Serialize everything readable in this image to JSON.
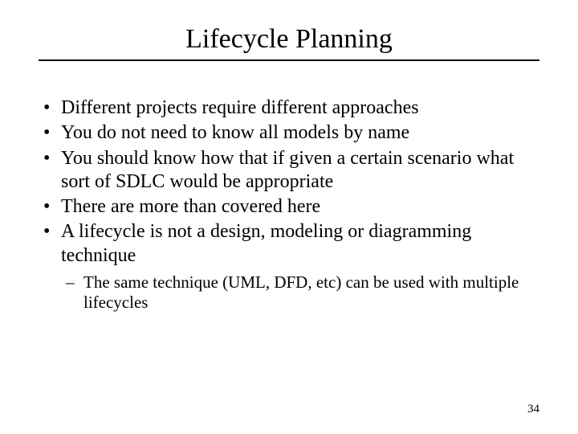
{
  "title": "Lifecycle Planning",
  "bullets": [
    "Different projects require different approaches",
    "You do not need to know all models by name",
    "You should know how that if given a certain scenario what sort of SDLC would be appropriate",
    "There are more than covered here",
    "A lifecycle is not a design, modeling or diagramming technique"
  ],
  "sub_bullets": [
    "The same technique (UML, DFD, etc) can be used with multiple lifecycles"
  ],
  "page_number": "34"
}
